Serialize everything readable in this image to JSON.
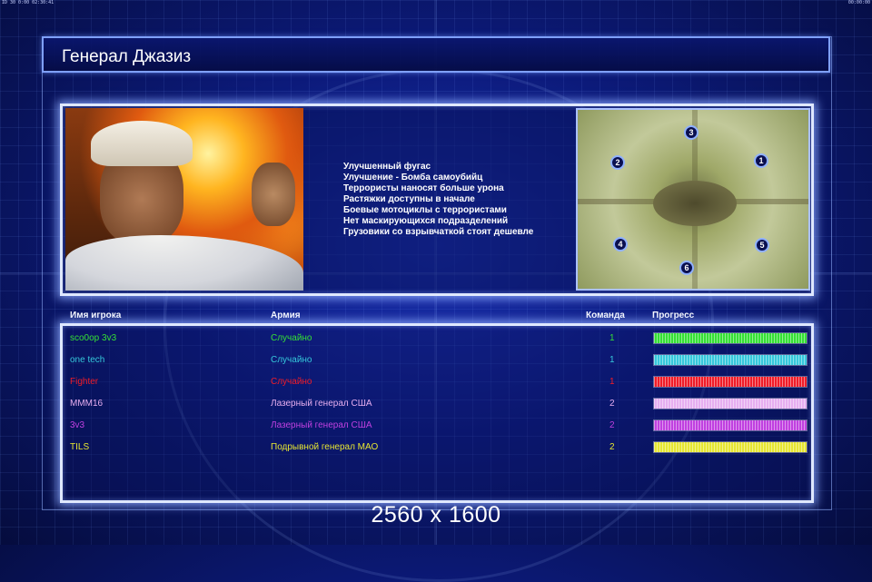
{
  "window": {
    "status_left": "ID 30 0:00 02:30:41",
    "status_right": "00:00:00"
  },
  "header": {
    "title": "Генерал Джазиз"
  },
  "general": {
    "bonuses": [
      "Улучшенный фугас",
      "Улучшение - Бомба самоубийц",
      "Террористы наносят больше урона",
      "Растяжки доступны в начале",
      "Боевые мотоциклы с террористами",
      "Нет маскирующихся подразделений",
      "Грузовики со взрывчаткой стоят дешевле"
    ]
  },
  "minimap": {
    "spawns": [
      "1",
      "2",
      "3",
      "4",
      "5",
      "6"
    ]
  },
  "table": {
    "columns": {
      "player": "Имя игрока",
      "army": "Армия",
      "team": "Команда",
      "progress": "Прогресс"
    },
    "rows": [
      {
        "name": "sco0op 3v3",
        "army": "Случайно",
        "team": "1",
        "color": "#35e035",
        "progress": 1.0
      },
      {
        "name": "one tech",
        "army": "Случайно",
        "team": "1",
        "color": "#36c8dc",
        "progress": 1.0
      },
      {
        "name": "Fighter",
        "army": "Случайно",
        "team": "1",
        "color": "#f01c28",
        "progress": 1.0
      },
      {
        "name": "MMM16",
        "army": "Лазерный генерал США",
        "team": "2",
        "color": "#e6aef0",
        "progress": 1.0
      },
      {
        "name": "3v3",
        "army": "Лазерный генерал США",
        "team": "2",
        "color": "#c040e0",
        "progress": 1.0
      },
      {
        "name": "TILS",
        "army": "Подрывной генерал МАО",
        "team": "2",
        "color": "#e6e632",
        "progress": 1.0
      }
    ]
  },
  "watermark": "2560 x 1600"
}
